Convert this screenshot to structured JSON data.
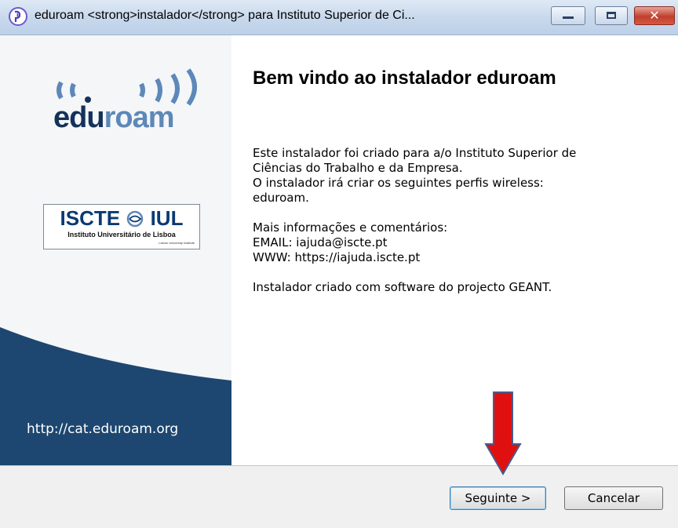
{
  "window": {
    "title": "eduroam <strong>instalador</strong>  para Instituto Superior de Ci...",
    "close_glyph": "✕"
  },
  "left_panel": {
    "logo_part1": "edu",
    "logo_part2": "roam",
    "institution_logo_title": "ISCTE",
    "institution_logo_title_right": "IUL",
    "institution_logo_subtitle": "Instituto Universitário de Lisboa",
    "institution_logo_subtitle2": "Lisbon University Institute",
    "url": "http://cat.eduroam.org"
  },
  "content": {
    "title": "Bem vindo ao instalador eduroam",
    "paragraph1_line1": "Este instalador foi criado para a/o Instituto Superior de",
    "paragraph1_line2": "Ciências do Trabalho e da Empresa.",
    "paragraph1_line3": "O instalador irá criar os seguintes perfis wireless:",
    "paragraph1_line4": "eduroam.",
    "info_heading": "Mais informações e comentários:",
    "email_line": "EMAIL: iajuda@iscte.pt",
    "www_line": "WWW: https://iajuda.iscte.pt",
    "footer_line": "Instalador criado com software do projecto GEANT."
  },
  "buttons": {
    "next_label": "Seguinte >",
    "cancel_label": "Cancelar"
  },
  "colors": {
    "panel_blue": "#1d4770",
    "arrow_red": "#e01010",
    "logo_dark": "#14325a",
    "logo_light": "#5d88b8"
  }
}
